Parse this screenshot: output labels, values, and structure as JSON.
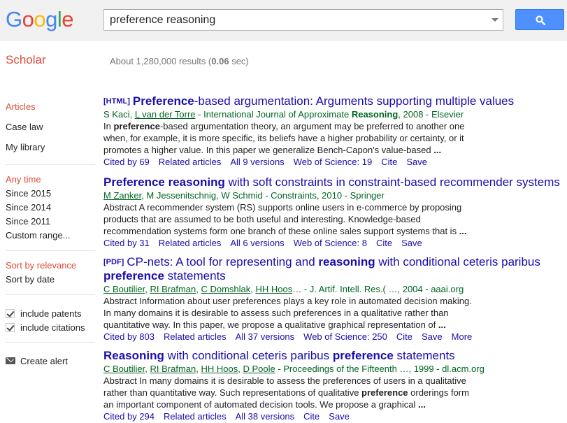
{
  "logo": {
    "letters": [
      "G",
      "o",
      "o",
      "g",
      "l",
      "e"
    ],
    "colors": [
      "#4285f4",
      "#ea4335",
      "#fbbc05",
      "#4285f4",
      "#34a853",
      "#ea4335"
    ]
  },
  "search": {
    "query": "preference reasoning"
  },
  "header": {
    "scholar_label": "Scholar",
    "stats_prefix": "About 1,280,000 results (",
    "stats_time": "0.06",
    "stats_suffix": " sec)"
  },
  "sidebar": {
    "group1": [
      "Articles",
      "Case law",
      "My library"
    ],
    "group2": [
      "Any time",
      "Since 2015",
      "Since 2014",
      "Since 2011",
      "Custom range..."
    ],
    "group3": [
      "Sort by relevance",
      "Sort by date"
    ],
    "checkboxes": [
      "include patents",
      "include citations"
    ],
    "alert": "Create alert"
  },
  "results": [
    {
      "tag": "[HTML]",
      "title_parts": [
        {
          "t": "Preference",
          "b": true
        },
        {
          "t": "-based argumentation: Arguments supporting multiple values",
          "b": false
        }
      ],
      "authors": [
        "S Kaci",
        "L van der Torre"
      ],
      "authors_linked": [
        false,
        true
      ],
      "venue_parts": [
        {
          "t": " - International Journal of Approximate ",
          "b": false
        },
        {
          "t": "Reasoning",
          "b": true
        },
        {
          "t": ", 2008 - Elsevier",
          "b": false
        }
      ],
      "snippet_lines": [
        [
          {
            "t": "In ",
            "b": false
          },
          {
            "t": "preference",
            "b": true
          },
          {
            "t": "-based argumentation theory, an argument may be preferred to another one",
            "b": false
          }
        ],
        [
          {
            "t": "when, for example, it is more specific, its beliefs have a higher probability or certainty, or it",
            "b": false
          }
        ],
        [
          {
            "t": "promotes a higher value. In this paper we generalize Bench-Capon's value-based ",
            "b": false
          },
          {
            "t": "...",
            "b": true
          }
        ]
      ],
      "links": [
        "Cited by 69",
        "Related articles",
        "All 9 versions",
        "Web of Science: 19",
        "Cite",
        "Save"
      ]
    },
    {
      "tag": "",
      "title_parts": [
        {
          "t": "Preference reasoning",
          "b": true
        },
        {
          "t": " with soft constraints in constraint-based recommender systems",
          "b": false
        }
      ],
      "authors": [
        "M Zanker",
        "M Jessenitschnig",
        "W Schmid"
      ],
      "authors_linked": [
        true,
        false,
        false
      ],
      "venue_parts": [
        {
          "t": " - Constraints, 2010 - Springer",
          "b": false
        }
      ],
      "snippet_lines": [
        [
          {
            "t": "Abstract A recommender system (RS) supports online users in e-commerce by proposing",
            "b": false
          }
        ],
        [
          {
            "t": "products that are assumed to be both useful and interesting. Knowledge-based",
            "b": false
          }
        ],
        [
          {
            "t": "recommendation systems form one branch of these online sales support systems that is ",
            "b": false
          },
          {
            "t": "...",
            "b": true
          }
        ]
      ],
      "links": [
        "Cited by 31",
        "Related articles",
        "All 6 versions",
        "Web of Science: 8",
        "Cite",
        "Save"
      ]
    },
    {
      "tag": "[PDF]",
      "title_parts": [
        {
          "t": "CP-nets: A tool for representing and ",
          "b": false
        },
        {
          "t": "reasoning",
          "b": true
        },
        {
          "t": " with conditional ceteris paribus",
          "b": false
        }
      ],
      "title_line2": [
        {
          "t": "preference",
          "b": true
        },
        {
          "t": " statements",
          "b": false
        }
      ],
      "authors": [
        "C Boutilier",
        "RI Brafman",
        "C Domshlak",
        "HH Hoos"
      ],
      "authors_linked": [
        true,
        true,
        true,
        true
      ],
      "venue_parts": [
        {
          "t": "… - J. Artif. Intell. Res.( …, 2004 - aaai.org",
          "b": false
        }
      ],
      "snippet_lines": [
        [
          {
            "t": "Abstract Information about user preferences plays a key role in automated decision making.",
            "b": false
          }
        ],
        [
          {
            "t": "In many domains it is desirable to assess such preferences in a qualitative rather than",
            "b": false
          }
        ],
        [
          {
            "t": "quantitative way. In this paper, we propose a qualitative graphical representation of ",
            "b": false
          },
          {
            "t": "...",
            "b": true
          }
        ]
      ],
      "links": [
        "Cited by 803",
        "Related articles",
        "All 37 versions",
        "Web of Science: 250",
        "Cite",
        "Save",
        "More"
      ]
    },
    {
      "tag": "",
      "title_parts": [
        {
          "t": "Reasoning",
          "b": true
        },
        {
          "t": " with conditional ceteris paribus ",
          "b": false
        },
        {
          "t": "preference",
          "b": true
        },
        {
          "t": " statements",
          "b": false
        }
      ],
      "authors": [
        "C Boutilier",
        "RI Brafman",
        "HH Hoos",
        "D Poole"
      ],
      "authors_linked": [
        true,
        true,
        true,
        true
      ],
      "venue_parts": [
        {
          "t": " - Proceedings of the Fifteenth …, 1999 - dl.acm.org",
          "b": false
        }
      ],
      "snippet_lines": [
        [
          {
            "t": "Abstract In many domains it is desirable to assess the preferences of users in a qualitative",
            "b": false
          }
        ],
        [
          {
            "t": "rather than quantitative way. Such representations of qualitative ",
            "b": false
          },
          {
            "t": "preference",
            "b": true
          },
          {
            "t": " orderings form",
            "b": false
          }
        ],
        [
          {
            "t": "an important component of automated decision tools. We propose a graphical ",
            "b": false
          },
          {
            "t": "...",
            "b": true
          }
        ]
      ],
      "links": [
        "Cited by 294",
        "Related articles",
        "All 38 versions",
        "Cite",
        "Save"
      ]
    }
  ]
}
